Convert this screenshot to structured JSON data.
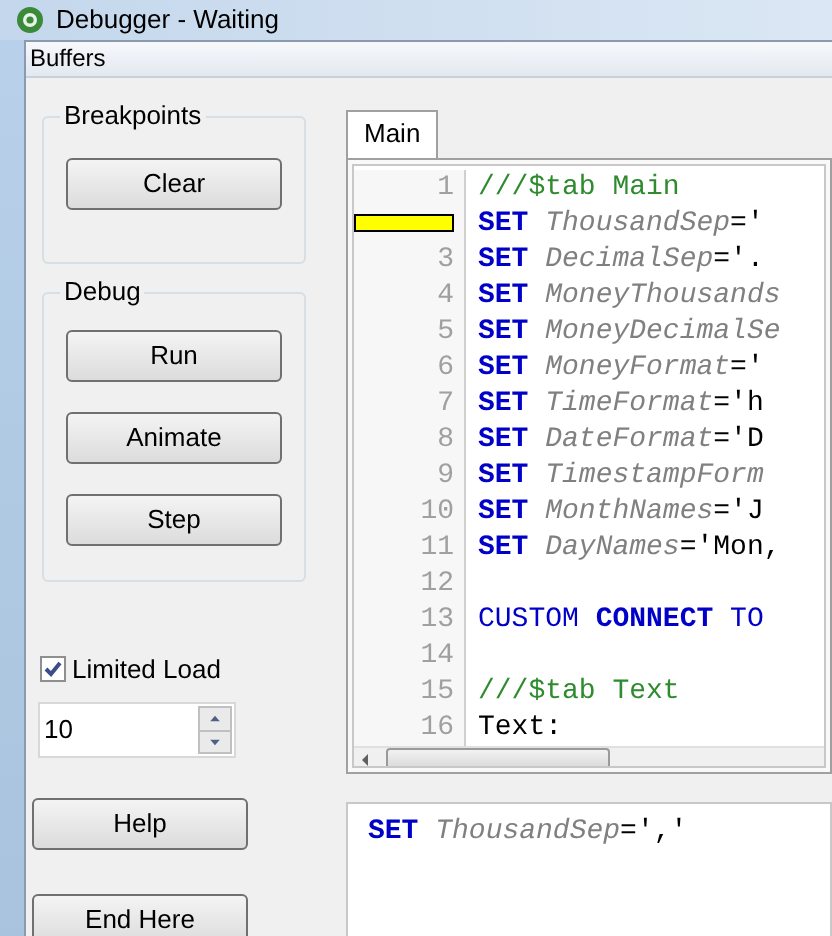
{
  "window": {
    "title": "Debugger - Waiting"
  },
  "menu": [
    "Buffers"
  ],
  "breakpoints_group": {
    "title": "Breakpoints",
    "buttons": [
      "Clear"
    ]
  },
  "debug_group": {
    "title": "Debug",
    "buttons": [
      "Run",
      "Animate",
      "Step"
    ]
  },
  "limited_load": {
    "label": "Limited Load",
    "checked": true,
    "value": "10"
  },
  "buttons": [
    "Help",
    "End Here"
  ],
  "tabs": [
    {
      "label": "Main",
      "selected": true
    }
  ],
  "editor": {
    "lines": [
      {
        "number": "1",
        "breakpoint": false,
        "segments": [
          {
            "kind": "comment",
            "text": "///$tab Main"
          }
        ]
      },
      {
        "breakpoint": true,
        "segments": [
          {
            "kind": "keyword",
            "text": "SET"
          },
          {
            "kind": "variable",
            "text": "ThousandSep"
          },
          {
            "kind": "plain",
            "text": "='"
          }
        ]
      },
      {
        "number": "3",
        "breakpoint": false,
        "segments": [
          {
            "kind": "keyword",
            "text": "SET"
          },
          {
            "kind": "variable",
            "text": "DecimalSep"
          },
          {
            "kind": "plain",
            "text": "='."
          }
        ]
      },
      {
        "number": "4",
        "breakpoint": false,
        "segments": [
          {
            "kind": "keyword",
            "text": "SET"
          },
          {
            "kind": "variable",
            "text": "MoneyThousands"
          }
        ]
      },
      {
        "number": "5",
        "breakpoint": false,
        "segments": [
          {
            "kind": "keyword",
            "text": "SET"
          },
          {
            "kind": "variable",
            "text": "MoneyDecimalSe"
          }
        ]
      },
      {
        "number": "6",
        "breakpoint": false,
        "segments": [
          {
            "kind": "keyword",
            "text": "SET"
          },
          {
            "kind": "variable",
            "text": "MoneyFormat"
          },
          {
            "kind": "plain",
            "text": "='"
          }
        ]
      },
      {
        "number": "7",
        "breakpoint": false,
        "segments": [
          {
            "kind": "keyword",
            "text": "SET"
          },
          {
            "kind": "variable",
            "text": "TimeFormat"
          },
          {
            "kind": "plain",
            "text": "='h"
          }
        ]
      },
      {
        "number": "8",
        "breakpoint": false,
        "segments": [
          {
            "kind": "keyword",
            "text": "SET"
          },
          {
            "kind": "variable",
            "text": "DateFormat"
          },
          {
            "kind": "plain",
            "text": "='D"
          }
        ]
      },
      {
        "number": "9",
        "breakpoint": false,
        "segments": [
          {
            "kind": "keyword",
            "text": "SET"
          },
          {
            "kind": "variable",
            "text": "TimestampForm"
          }
        ]
      },
      {
        "number": "10",
        "breakpoint": false,
        "segments": [
          {
            "kind": "keyword",
            "text": "SET"
          },
          {
            "kind": "variable",
            "text": "MonthNames"
          },
          {
            "kind": "plain",
            "text": "='J"
          }
        ]
      },
      {
        "number": "11",
        "breakpoint": false,
        "segments": [
          {
            "kind": "keyword",
            "text": "SET"
          },
          {
            "kind": "variable",
            "text": "DayNames"
          },
          {
            "kind": "plain",
            "text": "='Mon,"
          }
        ]
      },
      {
        "number": "12",
        "breakpoint": false
      },
      {
        "number": "13",
        "breakpoint": false,
        "segments": [
          {
            "kind": "custom",
            "text": "CUSTOM"
          },
          {
            "kind": "keyword",
            "text": "CONNECT"
          },
          {
            "kind": "custom",
            "text": "TO"
          }
        ]
      },
      {
        "number": "14",
        "breakpoint": false
      },
      {
        "number": "15",
        "breakpoint": false,
        "segments": [
          {
            "kind": "comment",
            "text": "///$tab Text"
          }
        ]
      },
      {
        "number": "16",
        "breakpoint": false,
        "segments": [
          {
            "kind": "plain",
            "text": "Text:"
          }
        ]
      }
    ]
  },
  "current_statement": [
    {
      "kind": "keyword",
      "text": "SET"
    },
    {
      "kind": "variable",
      "text": "ThousandSep"
    },
    {
      "kind": "plain",
      "text": "=','"
    }
  ]
}
